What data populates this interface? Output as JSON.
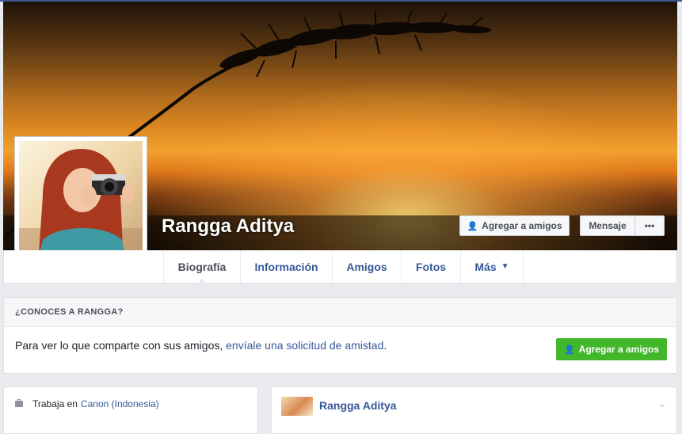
{
  "profile": {
    "name": "Rangga Aditya"
  },
  "actions": {
    "add_friend_label": "Agregar a amigos",
    "message_label": "Mensaje",
    "more_label": "•••"
  },
  "tabs": [
    {
      "label": "Biografía",
      "active": true
    },
    {
      "label": "Información"
    },
    {
      "label": "Amigos"
    },
    {
      "label": "Fotos"
    },
    {
      "label": "Más"
    }
  ],
  "know_card": {
    "header": "¿CONOCES A RANGGA?",
    "body_text": "Para ver lo que comparte con sus amigos, ",
    "body_link": "envíale una solicitud de amistad",
    "body_end": ".",
    "button_label": "Agregar a amigos"
  },
  "intro": {
    "work_prefix": "Trabaja en",
    "work_company": "Canon (Indonesia)"
  },
  "post": {
    "author": "Rangga Aditya"
  },
  "colors": {
    "link": "#365899",
    "green": "#42b72a",
    "background": "#e9ebee"
  }
}
